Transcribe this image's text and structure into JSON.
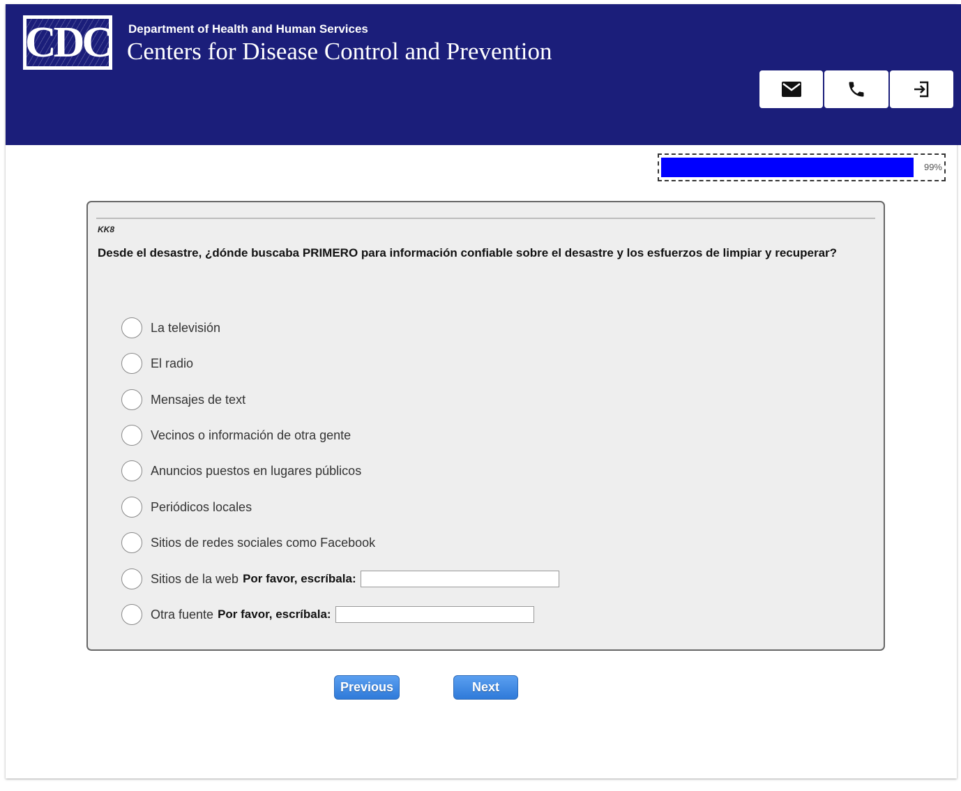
{
  "header": {
    "logo_text": "CDC",
    "department": "Department of Health and Human Services",
    "agency": "Centers for Disease Control and Prevention",
    "background_color": "#1b1e7a",
    "actions": [
      {
        "icon": "envelope-icon"
      },
      {
        "icon": "phone-icon"
      },
      {
        "icon": "exit-icon"
      }
    ]
  },
  "progress": {
    "percent": 99,
    "label": "99%",
    "fill_color": "#0000ff"
  },
  "question": {
    "id": "KK8",
    "text": "Desde el desastre, ¿dónde buscaba PRIMERO para información confiable sobre el desastre y los esfuerzos de limpiar y recuperar?",
    "options": [
      {
        "label": "La televisión"
      },
      {
        "label": "El radio"
      },
      {
        "label": "Mensajes de text"
      },
      {
        "label": "Vecinos o información de otra gente"
      },
      {
        "label": "Anuncios puestos en lugares públicos"
      },
      {
        "label": "Periódicos locales"
      },
      {
        "label": "Sitios de redes sociales como Facebook"
      },
      {
        "label": "Sitios de la web",
        "specify_label": "Por favor, escríbala:",
        "specify_value": ""
      },
      {
        "label": "Otra fuente",
        "specify_label": "Por favor, escríbala:",
        "specify_value": ""
      }
    ]
  },
  "nav": {
    "previous_label": "Previous",
    "next_label": "Next",
    "button_color": "#3d8ae6"
  }
}
